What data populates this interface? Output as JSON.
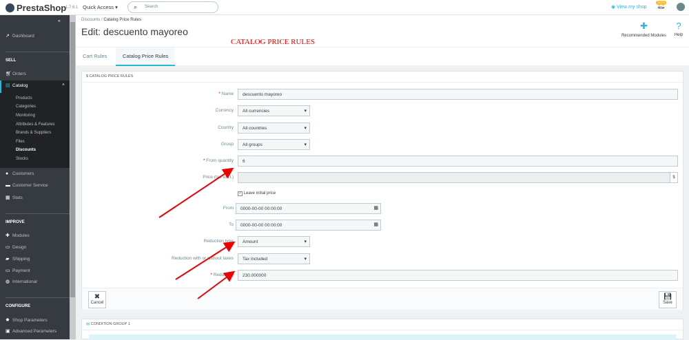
{
  "header": {
    "logo": "PrestaShop",
    "version": "1.7.6.1",
    "quick_access": "Quick Access ▾",
    "search_placeholder": "Search",
    "view_shop": "View my shop",
    "notif_count": "1171"
  },
  "sidebar": {
    "dashboard": "Dashboard",
    "sell": "SELL",
    "orders": "Orders",
    "catalog": "Catalog",
    "catalog_sub": [
      "Products",
      "Categories",
      "Monitoring",
      "Attributes & Features",
      "Brands & Suppliers",
      "Files",
      "Discounts",
      "Stocks"
    ],
    "customers": "Customers",
    "customer_service": "Customer Service",
    "stats": "Stats",
    "improve": "IMPROVE",
    "modules": "Modules",
    "design": "Design",
    "shipping": "Shipping",
    "payment": "Payment",
    "international": "International",
    "configure": "CONFIGURE",
    "shop_parameters": "Shop Parameters",
    "advanced_parameters": "Advanced Parameters"
  },
  "breadcrumb": {
    "parent": "Discounts",
    "sep": "/",
    "current": "Catalog Price Rules"
  },
  "page_title": "Edit: descuento mayoreo",
  "toolbar": {
    "recommended_modules": "Recommended Modules",
    "help": "Help"
  },
  "annotation": "CATALOG PRICE RULES",
  "tabs": [
    "Cart Rules",
    "Catalog Price Rules"
  ],
  "panel": {
    "heading": "$ CATALOG PRICE RULES",
    "fields": {
      "name_label": "Name",
      "name_value": "descuento mayoreo",
      "currency_label": "Currency",
      "currency_value": "All currencies",
      "country_label": "Country",
      "country_value": "All countries",
      "group_label": "Group",
      "group_value": "All groups",
      "from_qty_label": "From quantity",
      "from_qty_value": "6",
      "price_label": "Price (tax excl.)",
      "price_value": "",
      "price_addon": "$",
      "leave_initial": "Leave initial price",
      "from_label": "From",
      "from_value": "0000-00-00 00:00:00",
      "to_label": "To",
      "to_value": "0000-00-00 00:00:00",
      "reduction_type_label": "Reduction type",
      "reduction_type_value": "Amount",
      "reduction_tax_label": "Reduction with or without taxes",
      "reduction_tax_value": "Tax included",
      "reduction_label": "Reduction",
      "reduction_value": "230.000000"
    },
    "cancel": "Cancel",
    "save": "Save"
  },
  "condition_group": "CONDITION GROUP 1",
  "colors": {
    "accent": "#25b9d7",
    "sidebar": "#363a41",
    "annotation": "#ee0000"
  }
}
